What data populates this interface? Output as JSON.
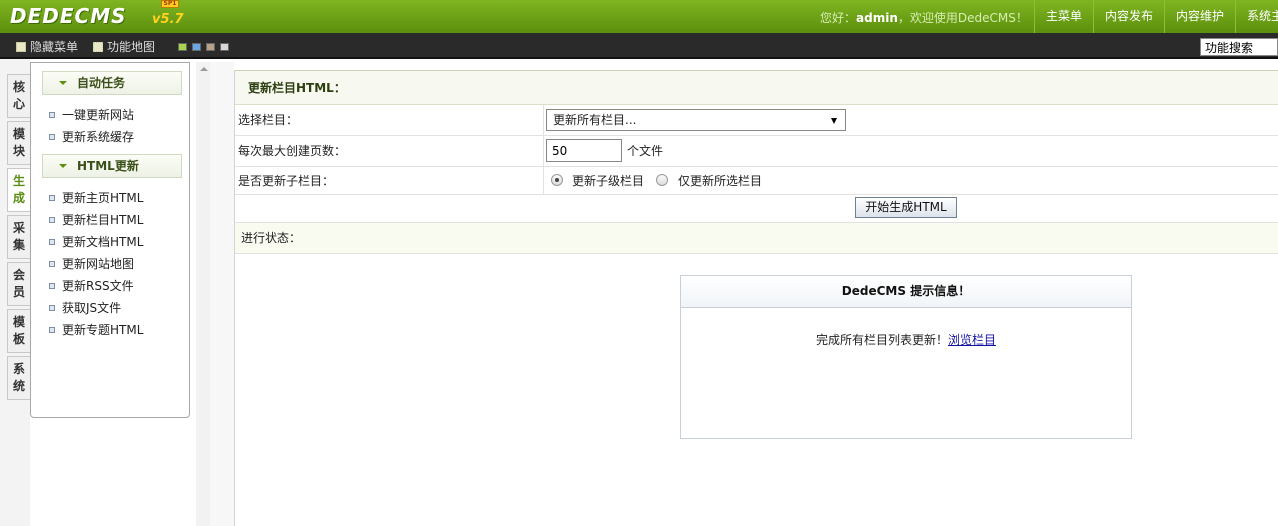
{
  "header": {
    "logo": "DEDECMS",
    "version": "v5.7",
    "badge": "SP1",
    "welcome_prefix": "您好：",
    "user": "admin",
    "welcome_suffix": "，欢迎使用DedeCMS！",
    "nav": [
      "主菜单",
      "内容发布",
      "内容维护",
      "系统主"
    ]
  },
  "toolbar": {
    "hide_menu": "隐藏菜单",
    "site_map": "功能地图",
    "search_value": "功能搜索",
    "swatches": [
      "#a7d64a",
      "#6aa6e4",
      "#b9a089",
      "#d8d8d8"
    ]
  },
  "left_tabs": [
    {
      "line1": "核",
      "line2": "心"
    },
    {
      "line1": "模",
      "line2": "块"
    },
    {
      "line1": "生",
      "line2": "成"
    },
    {
      "line1": "采",
      "line2": "集"
    },
    {
      "line1": "会",
      "line2": "员"
    },
    {
      "line1": "模",
      "line2": "板"
    },
    {
      "line1": "系",
      "line2": "统"
    }
  ],
  "menu": {
    "group1": {
      "title": "自动任务",
      "items": [
        "一键更新网站",
        "更新系统缓存"
      ]
    },
    "group2": {
      "title": "HTML更新",
      "items": [
        "更新主页HTML",
        "更新栏目HTML",
        "更新文档HTML",
        "更新网站地图",
        "更新RSS文件",
        "获取JS文件",
        "更新专题HTML"
      ]
    }
  },
  "main": {
    "title": "更新栏目HTML：",
    "row_select_label": "选择栏目：",
    "select_value": "更新所有栏目...",
    "row_max_label": "每次最大创建页数：",
    "max_value": "50",
    "max_unit": "个文件",
    "row_sub_label": "是否更新子栏目：",
    "radio_options": [
      "更新子级栏目",
      "仅更新所选栏目"
    ],
    "button": "开始生成HTML",
    "status_label": "进行状态："
  },
  "message": {
    "title": "DedeCMS 提示信息！",
    "text": "完成所有栏目列表更新！",
    "link": "浏览栏目"
  }
}
